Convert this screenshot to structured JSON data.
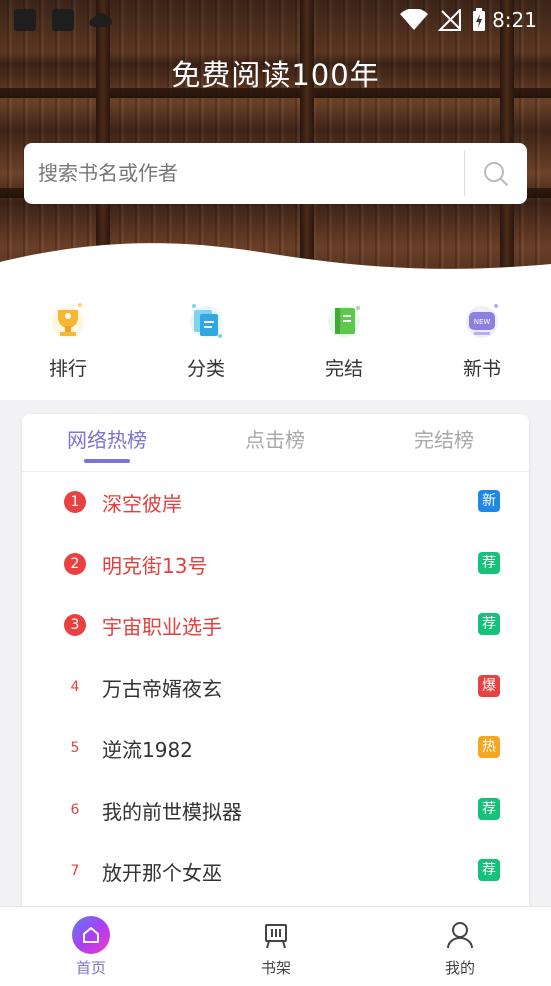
{
  "status_bar": {
    "time": "8:21"
  },
  "hero": {
    "title": "免费阅读100年"
  },
  "search": {
    "placeholder": "搜索书名或作者",
    "icon": "search-icon"
  },
  "quick_nav": [
    {
      "label": "排行",
      "icon": "trophy-icon"
    },
    {
      "label": "分类",
      "icon": "category-icon"
    },
    {
      "label": "完结",
      "icon": "finished-book-icon"
    },
    {
      "label": "新书",
      "icon": "new-book-icon"
    }
  ],
  "ranking": {
    "tabs": [
      {
        "label": "网络热榜",
        "active": true
      },
      {
        "label": "点击榜",
        "active": false
      },
      {
        "label": "完结榜",
        "active": false
      }
    ],
    "items": [
      {
        "rank": "1",
        "title": "深空彼岸",
        "tag": "新",
        "tag_color": "#1e88e5"
      },
      {
        "rank": "2",
        "title": "明克街13号",
        "tag": "荐",
        "tag_color": "#14c27a"
      },
      {
        "rank": "3",
        "title": "宇宙职业选手",
        "tag": "荐",
        "tag_color": "#14c27a"
      },
      {
        "rank": "4",
        "title": "万古帝婿夜玄",
        "tag": "爆",
        "tag_color": "#e8413f"
      },
      {
        "rank": "5",
        "title": "逆流1982",
        "tag": "热",
        "tag_color": "#f5a623"
      },
      {
        "rank": "6",
        "title": "我的前世模拟器",
        "tag": "荐",
        "tag_color": "#14c27a"
      },
      {
        "rank": "7",
        "title": "放开那个女巫",
        "tag": "荐",
        "tag_color": "#14c27a"
      }
    ]
  },
  "bottom_nav": [
    {
      "label": "首页",
      "icon": "home-icon",
      "active": true
    },
    {
      "label": "书架",
      "icon": "bookshelf-icon",
      "active": false
    },
    {
      "label": "我的",
      "icon": "profile-icon",
      "active": false
    }
  ],
  "colors": {
    "accent": "#7b74d2",
    "rank_red": "#e8413f"
  }
}
